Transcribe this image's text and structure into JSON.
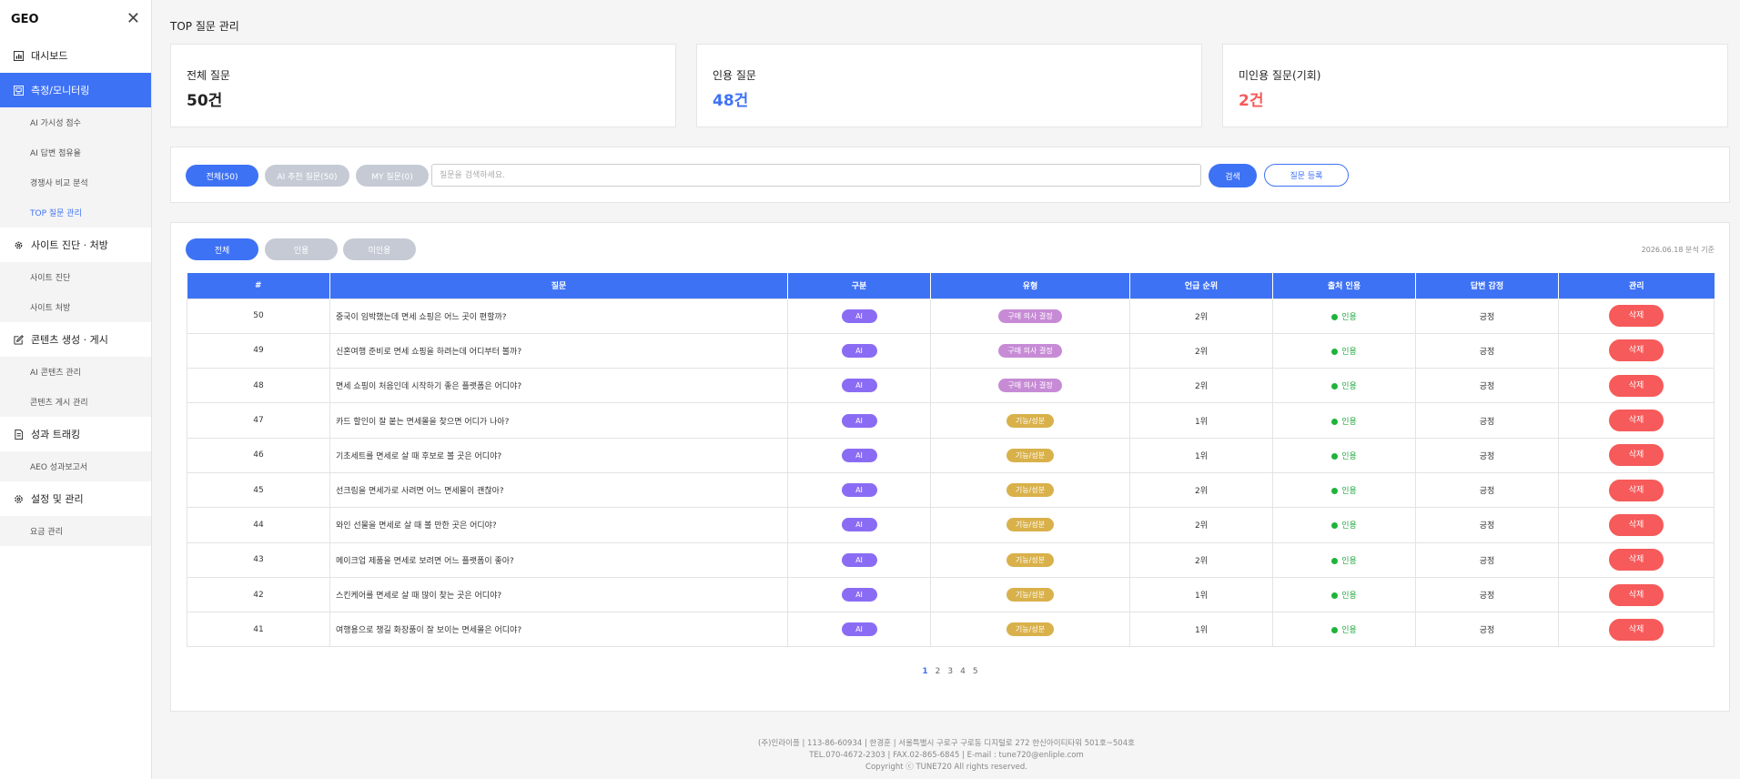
{
  "sidebar": {
    "title": "GEO",
    "close_icon": "close-icon",
    "sections": [
      {
        "label": "대시보드",
        "icon": "chart-icon",
        "items": []
      },
      {
        "label": "측정/모니터링",
        "icon": "monitor-icon",
        "items": [
          "AI 가시성 점수",
          "AI 답변 점유율",
          "경쟁사 비교 분석",
          "TOP 질문 관리"
        ]
      },
      {
        "label": "사이트 진단 · 처방",
        "icon": "gear-icon",
        "items": [
          "사이트 진단",
          "사이트 처방"
        ]
      },
      {
        "label": "콘텐츠 생성 · 게시",
        "icon": "edit-icon",
        "items": [
          "AI 콘텐츠 관리",
          "콘텐츠 게시 관리"
        ]
      },
      {
        "label": "성과 트래킹",
        "icon": "document-icon",
        "items": [
          "AEO 성과보고서"
        ]
      },
      {
        "label": "설정 및 관리",
        "icon": "settings-icon",
        "items": [
          "요금 관리"
        ]
      }
    ],
    "active_section": "측정/모니터링",
    "active_item": "TOP 질문 관리"
  },
  "page": {
    "title": "TOP 질문 관리"
  },
  "stats": [
    {
      "label": "전체 질문",
      "value": "50건",
      "color": "#222222"
    },
    {
      "label": "인용 질문",
      "value": "48건",
      "color": "#3e72f5"
    },
    {
      "label": "미인용 질문(기회)",
      "value": "2건",
      "color": "#f65a5a"
    }
  ],
  "filters": {
    "tabs": [
      "전체(50)",
      "AI 추천 질문(50)",
      "MY 질문(0)"
    ],
    "active_tab": "전체(50)",
    "search_placeholder": "질문을 검색하세요.",
    "search_value": "",
    "search_button": "검색",
    "register_button": "질문 등록"
  },
  "table_filters": {
    "tabs": [
      "전체",
      "인용",
      "미인용"
    ],
    "active_tab": "전체",
    "date_note": "2026.06.18 분석 기준"
  },
  "table": {
    "columns": [
      "#",
      "질문",
      "구분",
      "유형",
      "언급 순위",
      "출처 인용",
      "답변 감정",
      "관리"
    ],
    "rows": [
      {
        "no": "50",
        "question": "중국이 임박했는데 면세 쇼핑은 어느 곳이 편할까?",
        "category": "AI",
        "type": "구매 의사 결정",
        "rank": "2위",
        "citation": "인용",
        "sentiment": "긍정",
        "action": "삭제"
      },
      {
        "no": "49",
        "question": "신혼여행 준비로 면세 쇼핑을 하려는데 어디부터 볼까?",
        "category": "AI",
        "type": "구매 의사 결정",
        "rank": "2위",
        "citation": "인용",
        "sentiment": "긍정",
        "action": "삭제"
      },
      {
        "no": "48",
        "question": "면세 쇼핑이 처음인데 시작하기 좋은 플랫폼은 어디야?",
        "category": "AI",
        "type": "구매 의사 결정",
        "rank": "2위",
        "citation": "인용",
        "sentiment": "긍정",
        "action": "삭제"
      },
      {
        "no": "47",
        "question": "카드 할인이 잘 붙는 면세몰을 찾으면 어디가 나아?",
        "category": "AI",
        "type": "기능/성분",
        "rank": "1위",
        "citation": "인용",
        "sentiment": "긍정",
        "action": "삭제"
      },
      {
        "no": "46",
        "question": "기초세트를 면세로 살 때 후보로 볼 곳은 어디야?",
        "category": "AI",
        "type": "기능/성분",
        "rank": "1위",
        "citation": "인용",
        "sentiment": "긍정",
        "action": "삭제"
      },
      {
        "no": "45",
        "question": "선크림을 면세가로 사려면 어느 면세몰이 괜찮아?",
        "category": "AI",
        "type": "기능/성분",
        "rank": "2위",
        "citation": "인용",
        "sentiment": "긍정",
        "action": "삭제"
      },
      {
        "no": "44",
        "question": "와인 선물을 면세로 살 때 볼 만한 곳은 어디야?",
        "category": "AI",
        "type": "기능/성분",
        "rank": "2위",
        "citation": "인용",
        "sentiment": "긍정",
        "action": "삭제"
      },
      {
        "no": "43",
        "question": "메이크업 제품을 면세로 보려면 어느 플랫폼이 좋아?",
        "category": "AI",
        "type": "기능/성분",
        "rank": "2위",
        "citation": "인용",
        "sentiment": "긍정",
        "action": "삭제"
      },
      {
        "no": "42",
        "question": "스킨케어를 면세로 살 때 많이 찾는 곳은 어디야?",
        "category": "AI",
        "type": "기능/성분",
        "rank": "1위",
        "citation": "인용",
        "sentiment": "긍정",
        "action": "삭제"
      },
      {
        "no": "41",
        "question": "여행용으로 챙길 화장품이 잘 보이는 면세몰은 어디야?",
        "category": "AI",
        "type": "기능/성분",
        "rank": "1위",
        "citation": "인용",
        "sentiment": "긍정",
        "action": "삭제"
      }
    ]
  },
  "pagination": {
    "pages": [
      "1",
      "2",
      "3",
      "4",
      "5"
    ],
    "current": "1"
  },
  "footer": {
    "line1": "(주)인라이플 | 113-86-60934 | 한경훈 | 서울특별시 구로구 구로동 디지털로 272 한신아이티타워 501호~504호",
    "line2": "TEL.070-4672-2303 | FAX.02-865-6845 | E-mail : tune720@enliple.com",
    "line3": "Copyright ⓒ TUNE720 All rights reserved."
  },
  "colors": {
    "accent": "#3e72f5",
    "danger": "#f65a5a",
    "badge_ai": "#8a6cf4",
    "badge_purchase": "#c78bd6",
    "badge_feature": "#d9b14b",
    "cited": "#1fb33a"
  }
}
